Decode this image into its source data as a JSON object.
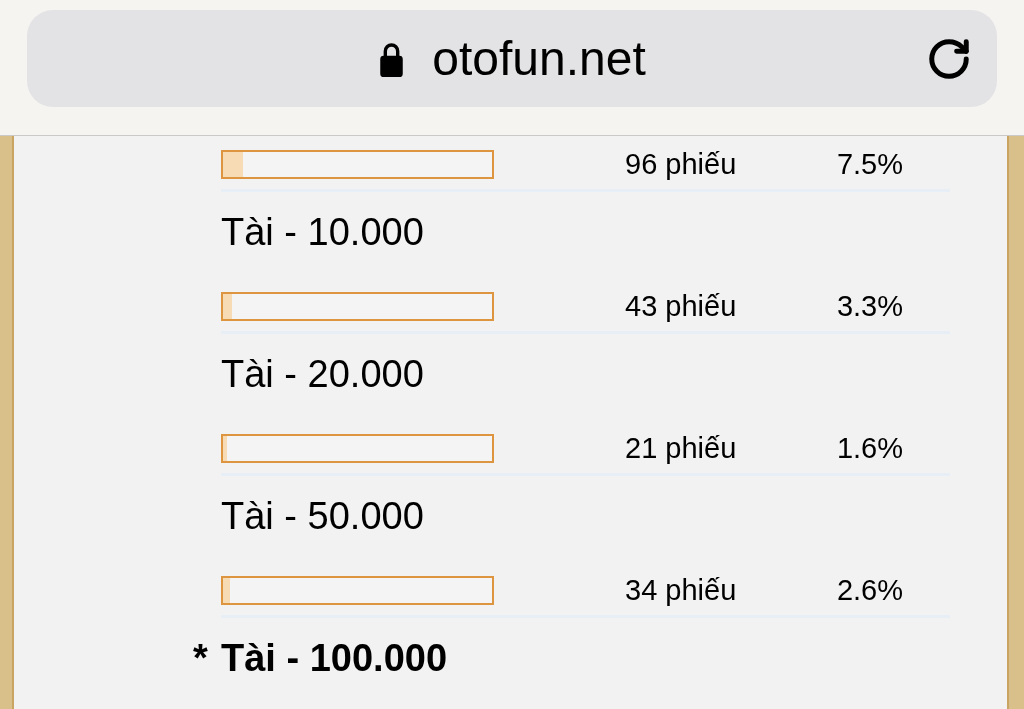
{
  "browser": {
    "url": "otofun.net"
  },
  "poll": {
    "options": [
      {
        "votes": "96 phiếu",
        "percent": "7.5%",
        "level": 0.075
      },
      {
        "label": "Tài - 10.000",
        "selected": false,
        "votes": "43 phiếu",
        "percent": "3.3%",
        "level": 0.033
      },
      {
        "label": "Tài - 20.000",
        "selected": false,
        "votes": "21 phiếu",
        "percent": "1.6%",
        "level": 0.016
      },
      {
        "label": "Tài - 50.000",
        "selected": false,
        "votes": "34 phiếu",
        "percent": "2.6%",
        "level": 0.026
      },
      {
        "label": "Tài - 100.000",
        "selected": true,
        "marker": "*"
      }
    ]
  }
}
